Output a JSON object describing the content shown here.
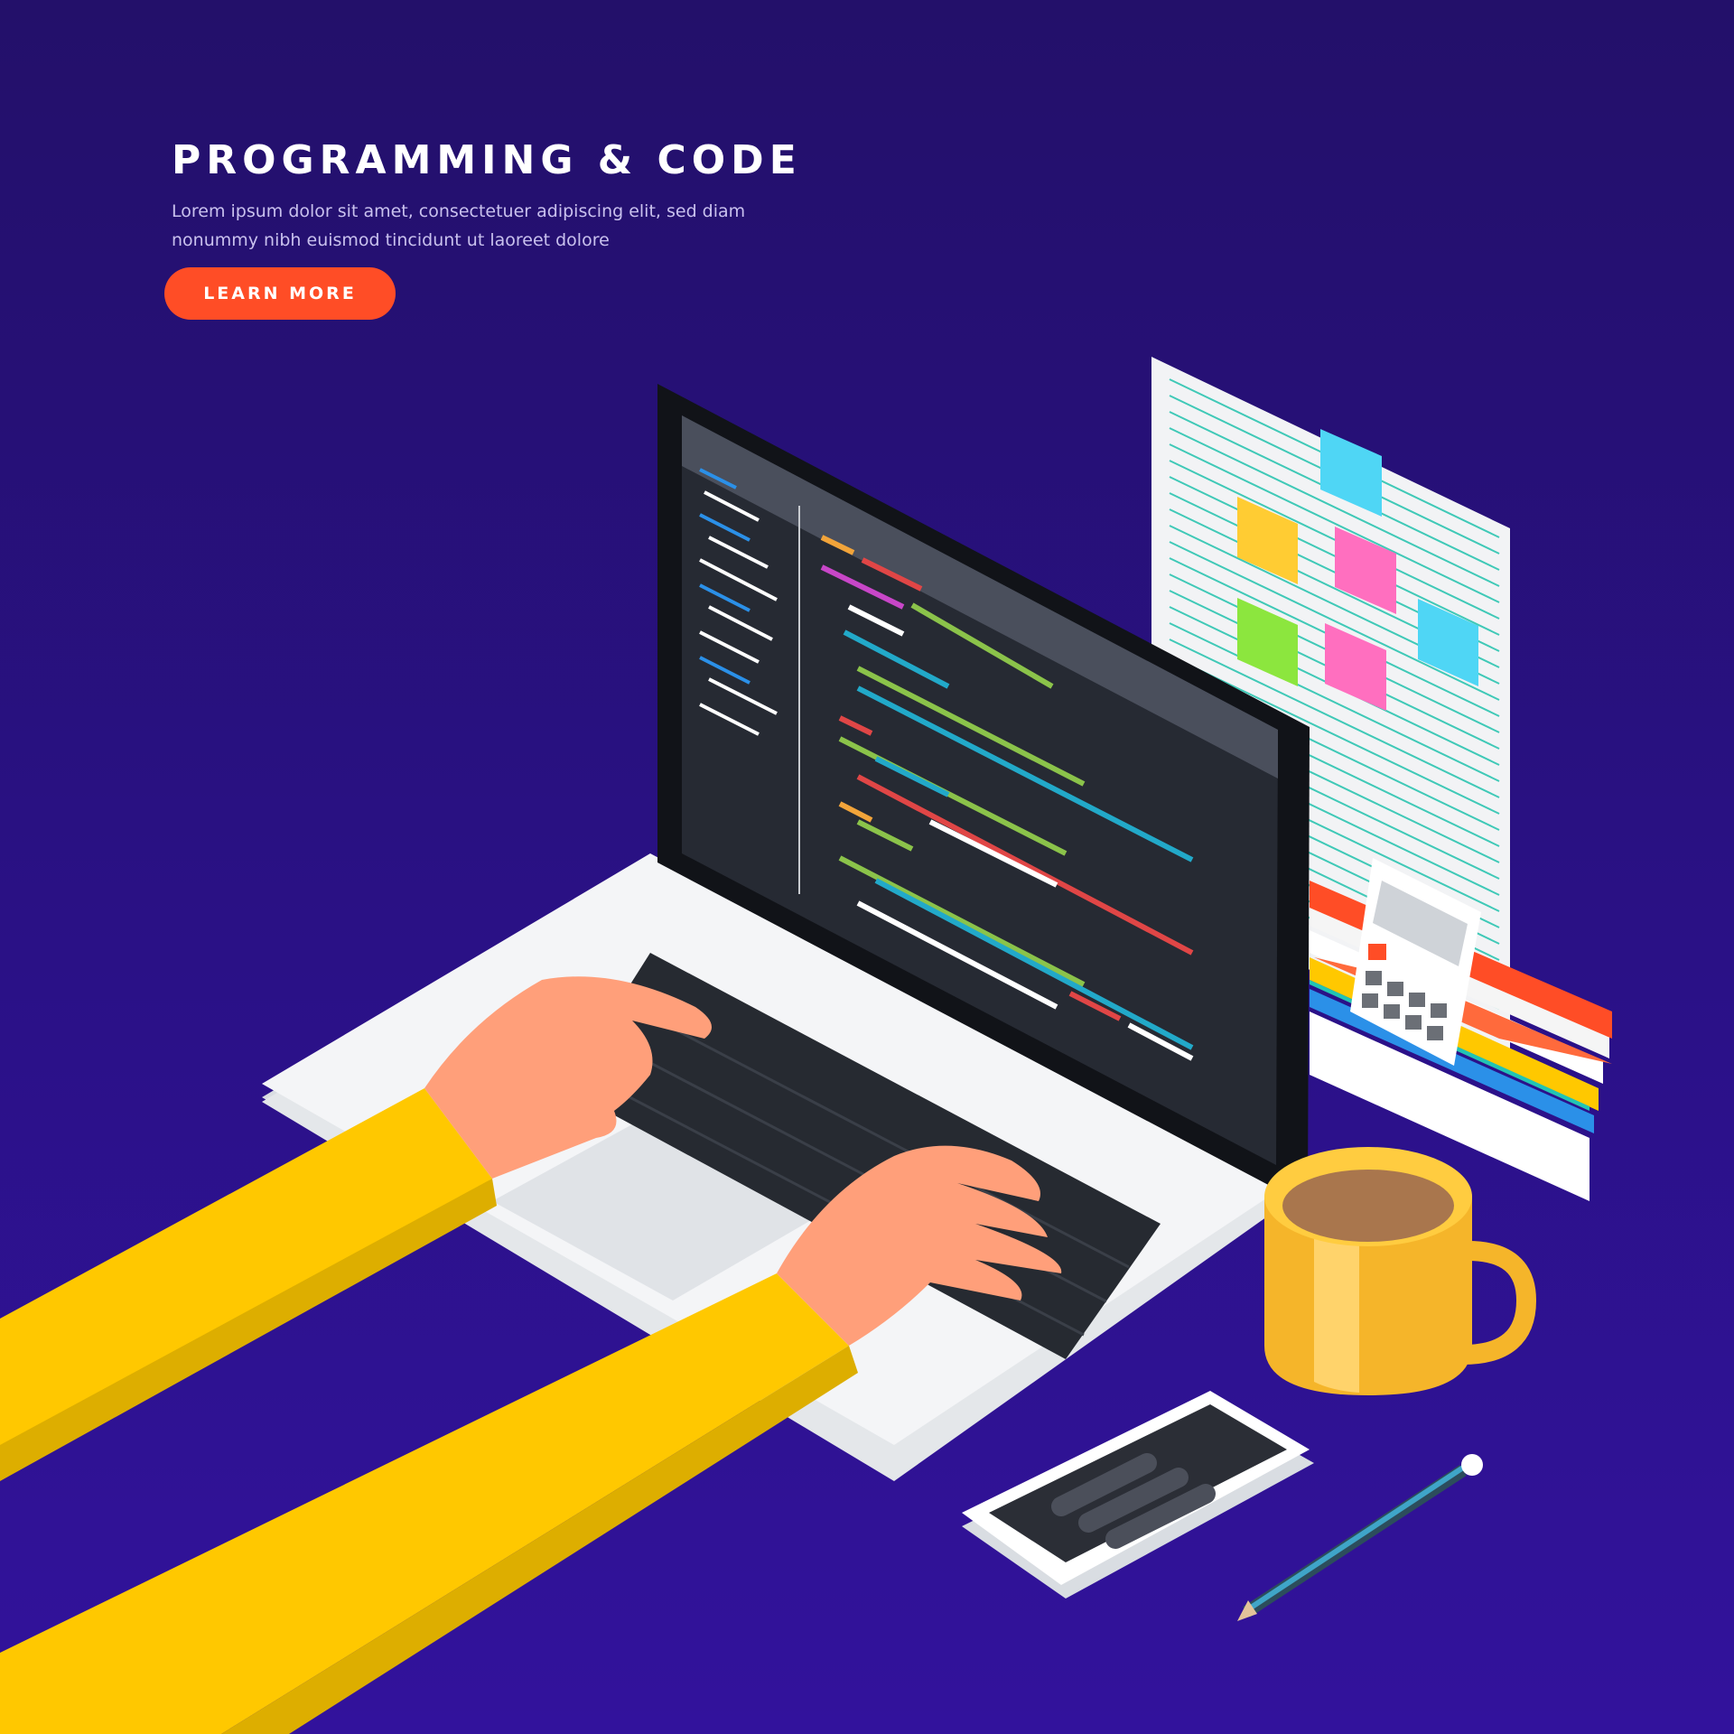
{
  "hero": {
    "title": "PROGRAMMING & CODE",
    "subtitle": "Lorem ipsum dolor sit amet, consectetuer adipiscing elit, sed diam nonummy nibh euismod tincidunt ut laoreet dolore",
    "cta_label": "LEARN MORE"
  },
  "colors": {
    "background": "#2a1186",
    "accent": "#ff4d26",
    "sleeve": "#ffc800",
    "skin": "#ff9f7a"
  },
  "illustration": {
    "objects": [
      "laptop-icon",
      "code-editor",
      "hands-icon",
      "notes-page-icon",
      "sticky-notes-icon",
      "calculator-icon",
      "books-icon",
      "coffee-mug-icon",
      "smartphone-icon",
      "pencil-icon"
    ]
  }
}
